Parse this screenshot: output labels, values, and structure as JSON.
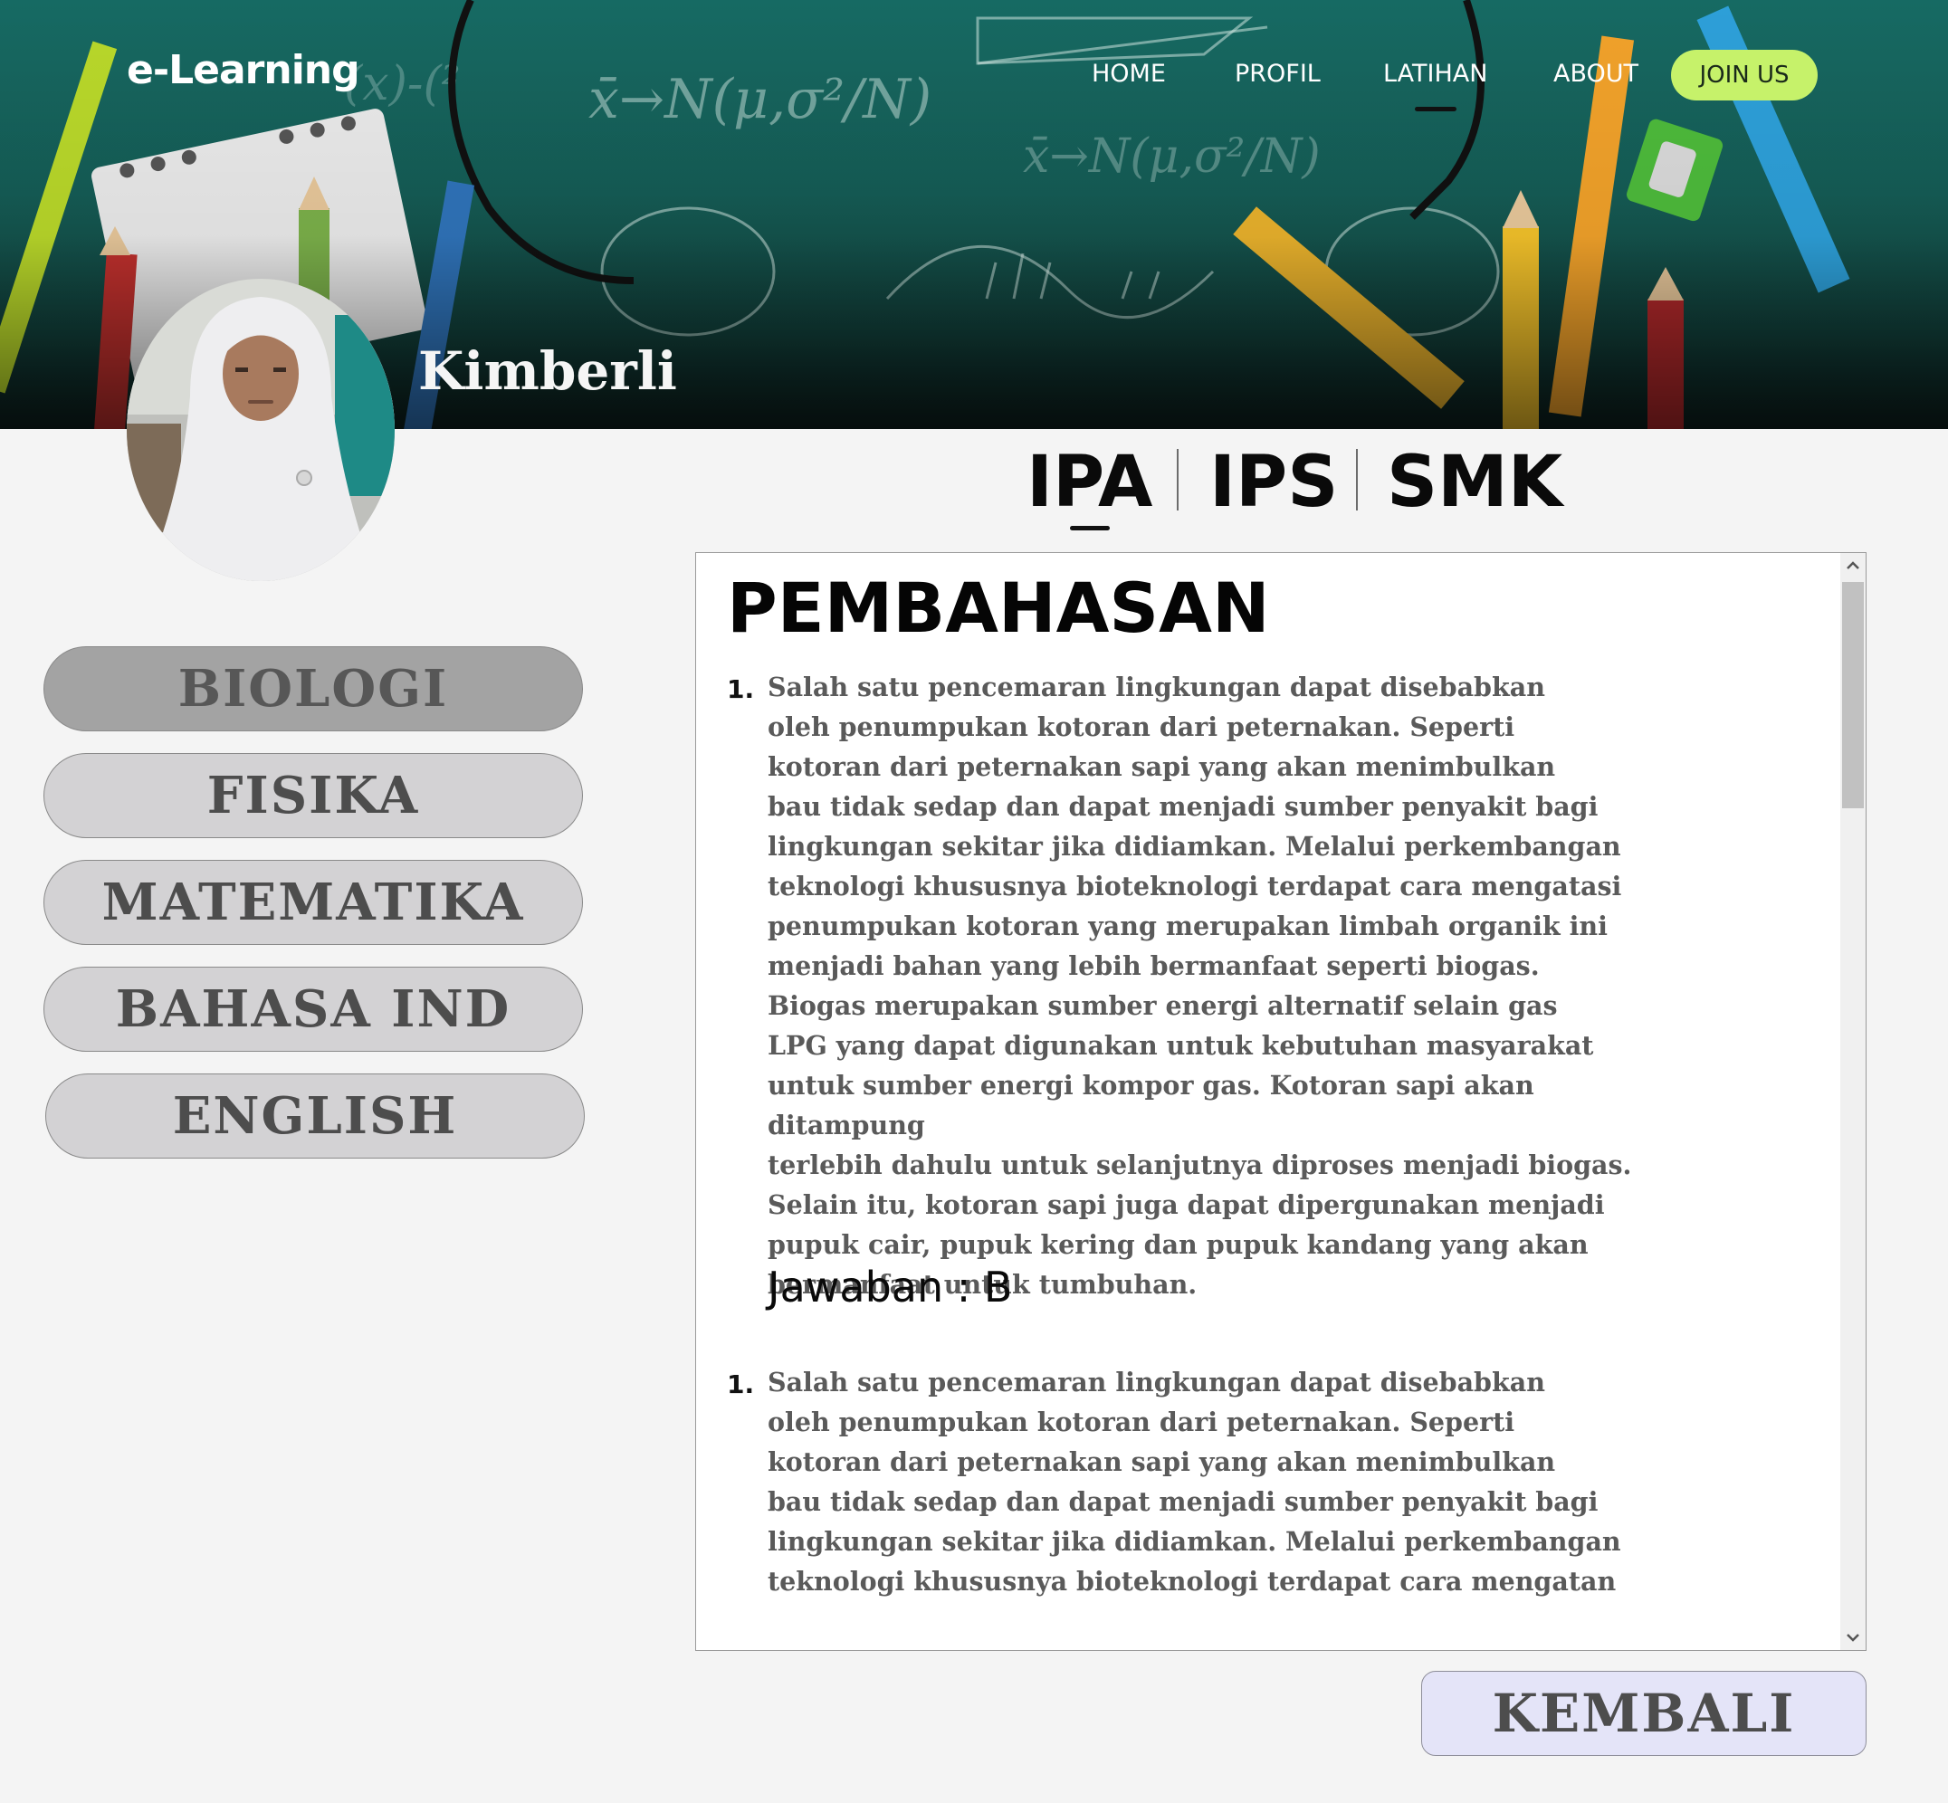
{
  "header": {
    "logo": "e-Learning",
    "nav": [
      {
        "label": "HOME"
      },
      {
        "label": "PROFIL"
      },
      {
        "label": "LATIHAN",
        "active": true
      },
      {
        "label": "ABOUT"
      }
    ],
    "join_label": "JOIN US",
    "join_color": "#c6f26a",
    "background_color": "#166a63"
  },
  "profile": {
    "name": "Kimberli",
    "avatar": "user-photo"
  },
  "subject_tabs": [
    {
      "label": "IPA",
      "active": true
    },
    {
      "label": "IPS"
    },
    {
      "label": "SMK"
    }
  ],
  "sidebar": {
    "items": [
      {
        "label": "BIOLOGI",
        "active": true
      },
      {
        "label": "FISIKA"
      },
      {
        "label": "MATEMATIKA"
      },
      {
        "label": "BAHASA IND"
      },
      {
        "label": "ENGLISH"
      }
    ]
  },
  "content": {
    "title": "PEMBAHASAN",
    "questions": [
      {
        "number": "1.",
        "text": "Salah satu pencemaran lingkungan dapat disebabkan\noleh penumpukan kotoran dari peternakan. Seperti\nkotoran dari peternakan sapi yang akan menimbulkan\nbau tidak sedap dan dapat menjadi sumber penyakit bagi\nlingkungan sekitar jika didiamkan. Melalui perkembangan\nteknologi khususnya bioteknologi terdapat cara mengatasi\npenumpukan kotoran yang merupakan limbah organik ini\nmenjadi bahan yang lebih bermanfaat seperti biogas.\nBiogas merupakan sumber energi alternatif selain gas\nLPG yang dapat digunakan untuk kebutuhan masyarakat\nuntuk sumber energi kompor gas. Kotoran sapi akan ditampung\nterlebih dahulu untuk selanjutnya diproses menjadi biogas.\nSelain itu, kotoran sapi juga dapat dipergunakan menjadi\npupuk cair, pupuk kering dan pupuk kandang yang akan\nbermanfaat untuk tumbuhan.",
        "answer": "Jawaban : B"
      },
      {
        "number": "1.",
        "text": "Salah satu pencemaran lingkungan dapat disebabkan\noleh penumpukan kotoran dari peternakan. Seperti\nkotoran dari peternakan sapi yang akan menimbulkan\nbau tidak sedap dan dapat menjadi sumber penyakit bagi\nlingkungan sekitar jika didiamkan. Melalui perkembangan\nteknologi khususnya bioteknologi terdapat cara mengatan"
      }
    ]
  },
  "back_button": {
    "label": "KEMBALI"
  }
}
